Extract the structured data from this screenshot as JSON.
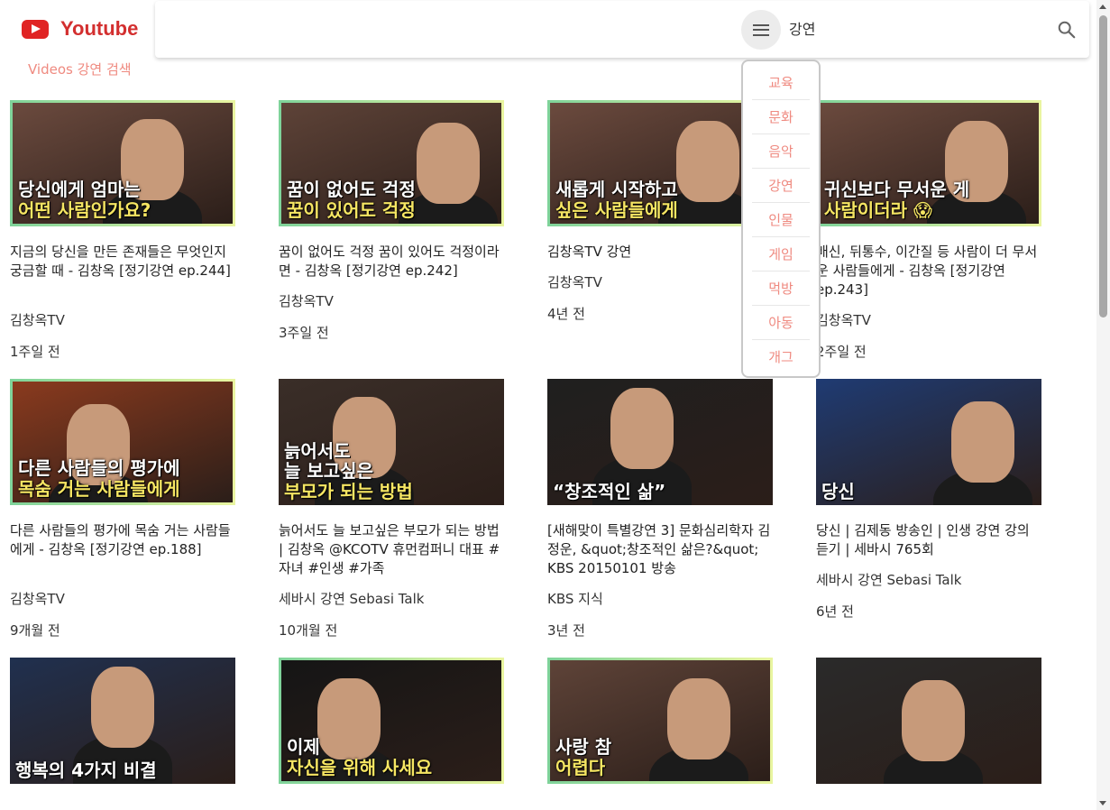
{
  "app": {
    "logo_text": "Youtube",
    "subtitle": "Videos 강연 검색"
  },
  "search": {
    "value": "강연"
  },
  "menu": {
    "items": [
      "교육",
      "문화",
      "음악",
      "강연",
      "인물",
      "게임",
      "먹방",
      "아동",
      "개그"
    ]
  },
  "colors": {
    "brand": "#d32f2f",
    "accent": "#ef8a80"
  },
  "videos": [
    {
      "title": "지금의 당신을 만든 존재들은 무엇인지 궁금할 때 - 김창옥 [정기강연 ep.244]",
      "channel": "김창옥TV",
      "age": "1주일 전",
      "thumb_lines": [
        "당신에게 엄마는",
        "어떤 사람인가요?"
      ],
      "bg": "#6b4a3e"
    },
    {
      "title": "꿈이 없어도 걱정 꿈이 있어도 걱정이라면 - 김창옥 [정기강연 ep.242]",
      "channel": "김창옥TV",
      "age": "3주일 전",
      "thumb_lines": [
        "꿈이 없어도 걱정",
        "꿈이 있어도 걱정"
      ],
      "bg": "#5e4338"
    },
    {
      "title": "김창옥TV 강연",
      "channel": "김창옥TV",
      "age": "4년 전",
      "thumb_lines": [
        "새롭게 시작하고",
        "싶은 사람들에게"
      ],
      "bg": "#6b4a3e"
    },
    {
      "title": "배신, 뒤통수, 이간질 등 사람이 더 무서운 사람들에게 - 김창옥 [정기강연 ep.243]",
      "channel": "김창옥TV",
      "age": "2주일 전",
      "thumb_lines": [
        "귀신보다 무서운 게",
        "사람이더라 😱"
      ],
      "bg": "#6b4a3e"
    },
    {
      "title": "다른 사람들의 평가에 목숨 거는 사람들에게 - 김창옥 [정기강연 ep.188]",
      "channel": "김창옥TV",
      "age": "9개월 전",
      "thumb_lines": [
        "다른 사람들의 평가에",
        "목숨 거는 사람들에게"
      ],
      "bg": "#8a3a1e"
    },
    {
      "title": "늙어서도 늘 보고싶은 부모가 되는 방법 | 김창옥 @KCOTV 휴먼컴퍼니 대표 #자녀 #인생 #가족",
      "channel": "세바시 강연 Sebasi Talk",
      "age": "10개월 전",
      "thumb_lines": [
        "늙어서도",
        "늘 보고싶은",
        "부모가 되는 방법"
      ],
      "bg": "#3a2e28"
    },
    {
      "title": "[새해맞이 특별강연 3] 문화심리학자 김정운, &quot;창조적인 삶은?&quot; KBS 20150101 방송",
      "channel": "KBS 지식",
      "age": "3년 전",
      "thumb_lines": [
        "“창조적인 삶”"
      ],
      "bg": "#1f1f1f"
    },
    {
      "title": "당신 | 김제동 방송인 | 인생 강연 강의 듣기 | 세바시 765회",
      "channel": "세바시 강연 Sebasi Talk",
      "age": "6년 전",
      "thumb_lines": [
        "당신"
      ],
      "bg": "#1f3b73"
    },
    {
      "title": "",
      "channel": "",
      "age": "",
      "thumb_lines": [
        "행복의 4가지 비결"
      ],
      "bg": "#20304f"
    },
    {
      "title": "",
      "channel": "",
      "age": "",
      "thumb_lines": [
        "이제",
        "자신을 위해 사세요"
      ],
      "bg": "#151515"
    },
    {
      "title": "",
      "channel": "",
      "age": "",
      "thumb_lines": [
        "사랑 참",
        "어렵다"
      ],
      "bg": "#5e4338"
    },
    {
      "title": "",
      "channel": "",
      "age": "",
      "thumb_lines": [],
      "bg": "#2a2a2a"
    }
  ]
}
